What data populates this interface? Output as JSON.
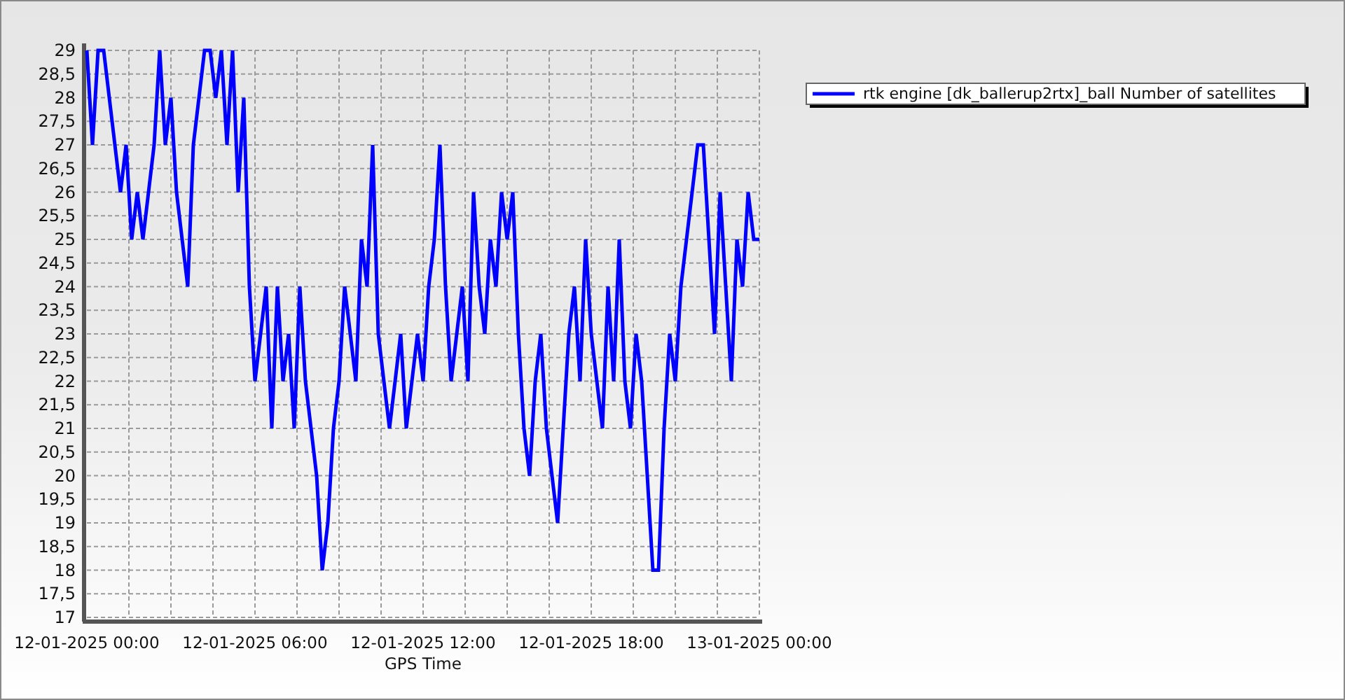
{
  "chart": {
    "chart_data": {
      "type": "line",
      "xlabel": "GPS Time",
      "categories": [
        "12-01-2025 00:00",
        null,
        null,
        null,
        null,
        null,
        null,
        null,
        null,
        null,
        null,
        null,
        null,
        null,
        null,
        null,
        null,
        null,
        null,
        null,
        null,
        null,
        null,
        null,
        null,
        null,
        null,
        null,
        null,
        null,
        "12-01-2025 06:00",
        null,
        null,
        null,
        null,
        null,
        null,
        null,
        null,
        null,
        null,
        null,
        null,
        null,
        null,
        null,
        null,
        null,
        null,
        null,
        null,
        null,
        null,
        null,
        null,
        null,
        null,
        null,
        null,
        null,
        "12-01-2025 12:00",
        null,
        null,
        null,
        null,
        null,
        null,
        null,
        null,
        null,
        null,
        null,
        null,
        null,
        null,
        null,
        null,
        null,
        null,
        null,
        null,
        null,
        null,
        null,
        null,
        null,
        null,
        null,
        null,
        null,
        "12-01-2025 18:00",
        null,
        null,
        null,
        null,
        null,
        null,
        null,
        null,
        null,
        null,
        null,
        null,
        null,
        null,
        null,
        null,
        null,
        null,
        null,
        null,
        null,
        null,
        null,
        null,
        null,
        null,
        null,
        null,
        null,
        "13-01-2025 00:00"
      ],
      "series": [
        {
          "name": "rtk engine [dk_ballerup2rtx]_ball Number of satellites",
          "color": "#0000ff",
          "values": [
            29,
            27,
            29,
            29,
            28,
            27,
            26,
            27,
            25,
            26,
            25,
            26,
            27,
            29,
            27,
            28,
            26,
            25,
            24,
            27,
            28,
            29,
            29,
            28,
            29,
            27,
            29,
            26,
            28,
            24,
            22,
            23,
            24,
            21,
            24,
            22,
            23,
            21,
            24,
            22,
            21,
            20,
            18,
            19,
            21,
            22,
            24,
            23,
            22,
            25,
            24,
            27,
            23,
            22,
            21,
            22,
            23,
            21,
            22,
            23,
            22,
            24,
            25,
            27,
            24,
            22,
            23,
            24,
            22,
            26,
            24,
            23,
            25,
            24,
            26,
            25,
            26,
            23,
            21,
            20,
            22,
            23,
            21,
            20,
            19,
            21,
            23,
            24,
            22,
            25,
            23,
            22,
            21,
            24,
            22,
            25,
            22,
            21,
            23,
            22,
            20,
            18,
            18,
            21,
            23,
            22,
            24,
            25,
            26,
            27,
            27,
            25,
            23,
            26,
            24,
            22,
            25,
            24,
            26,
            25,
            25
          ]
        }
      ],
      "ylim": [
        17,
        29
      ],
      "grid": true,
      "yticks": [
        {
          "value": 17,
          "label": "17"
        },
        {
          "value": 17.5,
          "label": "17,5"
        },
        {
          "value": 18,
          "label": "18"
        },
        {
          "value": 18.5,
          "label": "18,5"
        },
        {
          "value": 19,
          "label": "19"
        },
        {
          "value": 19.5,
          "label": "19,5"
        },
        {
          "value": 20,
          "label": "20"
        },
        {
          "value": 20.5,
          "label": "20,5"
        },
        {
          "value": 21,
          "label": "21"
        },
        {
          "value": 21.5,
          "label": "21,5"
        },
        {
          "value": 22,
          "label": "22"
        },
        {
          "value": 22.5,
          "label": "22,5"
        },
        {
          "value": 23,
          "label": "23"
        },
        {
          "value": 23.5,
          "label": "23,5"
        },
        {
          "value": 24,
          "label": "24"
        },
        {
          "value": 24.5,
          "label": "24,5"
        },
        {
          "value": 25,
          "label": "25"
        },
        {
          "value": 25.5,
          "label": "25,5"
        },
        {
          "value": 26,
          "label": "26"
        },
        {
          "value": 26.5,
          "label": "26,5"
        },
        {
          "value": 27,
          "label": "27"
        },
        {
          "value": 27.5,
          "label": "27,5"
        },
        {
          "value": 28,
          "label": "28"
        },
        {
          "value": 28.5,
          "label": "28,5"
        },
        {
          "value": 29,
          "label": "29"
        }
      ]
    }
  }
}
